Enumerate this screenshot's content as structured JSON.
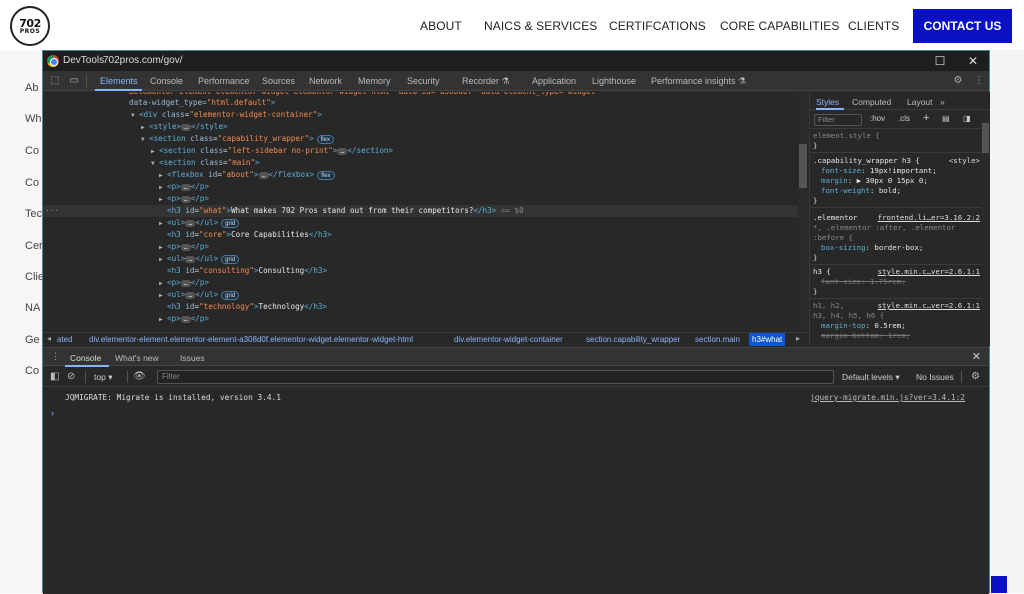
{
  "site": {
    "logo_line1": "702",
    "logo_line2": "PROS",
    "nav": [
      "ABOUT",
      "NAICS & SERVICES",
      "CERTIFCATIONS",
      "CORE CAPABILITIES",
      "CLIENTS"
    ],
    "contact_label": "CONTACT US",
    "sidebar_links": [
      "Ab",
      "Wh",
      "Co",
      "Co",
      "Tec",
      "Cer",
      "Clie",
      "NA",
      "Ge",
      "Co"
    ],
    "brand_color": "#0a10c4"
  },
  "devtools": {
    "title": "DevTools",
    "url": "702pros.com/gov/",
    "tabs": [
      "Elements",
      "Console",
      "Performance",
      "Sources",
      "Network",
      "Memory",
      "Security",
      "Recorder",
      "Application",
      "Lighthouse",
      "Performance insights"
    ],
    "active_tab": "Elements",
    "elements": {
      "lines": [
        {
          "text_prefix": "data-widget_type=",
          "value": "html.default",
          "suffix": ">"
        },
        {
          "tag": "div",
          "attr": "class",
          "value": "elementor-widget-container"
        },
        {
          "tag": "style"
        },
        {
          "tag": "section",
          "attr": "class",
          "value": "capability_wrapper",
          "badge": "flex"
        },
        {
          "tag": "section",
          "attr": "class",
          "value": "left-sidebar no-print"
        },
        {
          "tag": "section",
          "attr": "class",
          "value": "main"
        },
        {
          "tag": "flexbox",
          "attr": "id",
          "value": "about",
          "badge": "flex"
        },
        {
          "tag": "p"
        },
        {
          "tag": "p"
        },
        {
          "tag": "h3",
          "attr": "id",
          "value": "what",
          "text": "What makes 702 Pros stand out from their competitors?",
          "marker": "== $0"
        },
        {
          "tag": "ul",
          "badge": "grid"
        },
        {
          "tag": "h3",
          "attr": "id",
          "value": "core",
          "text": "Core Capabilities"
        },
        {
          "tag": "p"
        },
        {
          "tag": "ul",
          "badge": "grid"
        },
        {
          "tag": "h3",
          "attr": "id",
          "value": "consulting",
          "text": "Consulting"
        },
        {
          "tag": "p"
        },
        {
          "tag": "ul",
          "badge": "grid"
        },
        {
          "tag": "h3",
          "attr": "id",
          "value": "technology",
          "text": "Technology"
        },
        {
          "tag": "p"
        }
      ]
    },
    "breadcrumbs": [
      "ated",
      "div.elementor-element.elementor-element-a308d0f.elementor-widget.elementor-widget-html",
      "div.elementor-widget-container",
      "section.capability_wrapper",
      "section.main",
      "h3#what"
    ],
    "styles": {
      "tabs": [
        "Styles",
        "Computed",
        "Layout"
      ],
      "filter_placeholder": "Filter",
      "hov": ":hov",
      "cls": ".cls",
      "rules": [
        {
          "selector": "element.style {",
          "close": "}"
        },
        {
          "selector": ".capability_wrapper h3 {",
          "source": "<style>",
          "props": [
            {
              "name": "font-size",
              "value": "19px!important;"
            },
            {
              "name": "margin",
              "value": "▶ 30px 0 15px 0;"
            },
            {
              "name": "font-weight",
              "value": "bold;"
            }
          ]
        },
        {
          "selector": ".elementor",
          "source": "frontend.li…er=3.16.2:2",
          "extra": "*, .elementor :after, .elementor :before {",
          "props": [
            {
              "name": "box-sizing",
              "value": "border-box;"
            }
          ]
        },
        {
          "selector": "h3 {",
          "source": "style.min.c…ver=2.6.1:1",
          "props": [
            {
              "name": "font-size",
              "value": "1.75rem;",
              "struck": true
            }
          ]
        },
        {
          "selector": "h1, h2,",
          "source": "style.min.c…ver=2.6.1:1",
          "extra": "h3, h4, h5, h6 {",
          "props": [
            {
              "name": "margin-top",
              "value": "0.5rem;"
            },
            {
              "name": "margin-bottom",
              "value": "1rem;",
              "struck": true
            }
          ]
        }
      ]
    },
    "drawer": {
      "tabs": [
        "Console",
        "What's new",
        "Issues"
      ],
      "context": "top",
      "filter_placeholder": "Filter",
      "levels": "Default levels",
      "issues": "No Issues",
      "messages": [
        {
          "text": "JQMIGRATE: Migrate is installed, version 3.4.1",
          "source": "jquery-migrate.min.js?ver=3.4.1:2"
        }
      ],
      "prompt": "›"
    }
  }
}
